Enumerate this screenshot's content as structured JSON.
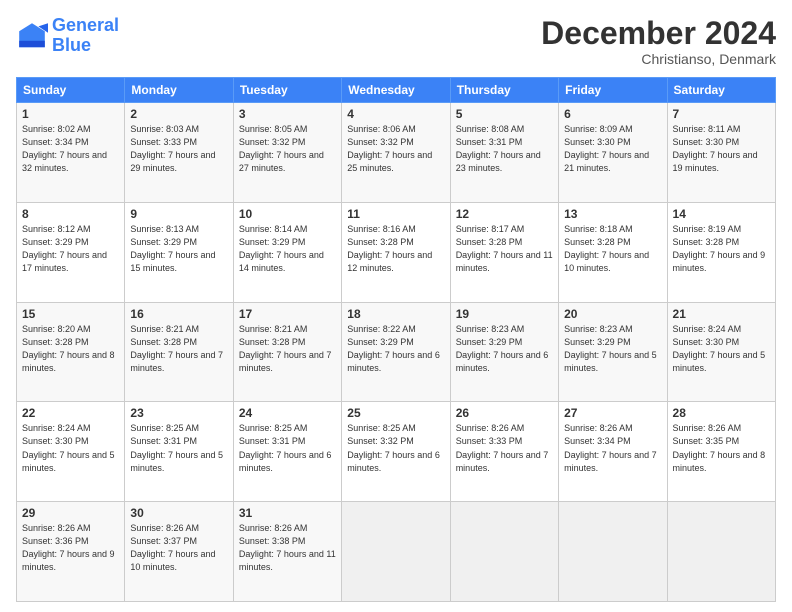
{
  "header": {
    "logo_line1": "General",
    "logo_line2": "Blue",
    "month": "December 2024",
    "location": "Christianso, Denmark"
  },
  "days_of_week": [
    "Sunday",
    "Monday",
    "Tuesday",
    "Wednesday",
    "Thursday",
    "Friday",
    "Saturday"
  ],
  "weeks": [
    [
      {
        "day": "1",
        "sunrise": "8:02 AM",
        "sunset": "3:34 PM",
        "daylight": "7 hours and 32 minutes."
      },
      {
        "day": "2",
        "sunrise": "8:03 AM",
        "sunset": "3:33 PM",
        "daylight": "7 hours and 29 minutes."
      },
      {
        "day": "3",
        "sunrise": "8:05 AM",
        "sunset": "3:32 PM",
        "daylight": "7 hours and 27 minutes."
      },
      {
        "day": "4",
        "sunrise": "8:06 AM",
        "sunset": "3:32 PM",
        "daylight": "7 hours and 25 minutes."
      },
      {
        "day": "5",
        "sunrise": "8:08 AM",
        "sunset": "3:31 PM",
        "daylight": "7 hours and 23 minutes."
      },
      {
        "day": "6",
        "sunrise": "8:09 AM",
        "sunset": "3:30 PM",
        "daylight": "7 hours and 21 minutes."
      },
      {
        "day": "7",
        "sunrise": "8:11 AM",
        "sunset": "3:30 PM",
        "daylight": "7 hours and 19 minutes."
      }
    ],
    [
      {
        "day": "8",
        "sunrise": "8:12 AM",
        "sunset": "3:29 PM",
        "daylight": "7 hours and 17 minutes."
      },
      {
        "day": "9",
        "sunrise": "8:13 AM",
        "sunset": "3:29 PM",
        "daylight": "7 hours and 15 minutes."
      },
      {
        "day": "10",
        "sunrise": "8:14 AM",
        "sunset": "3:29 PM",
        "daylight": "7 hours and 14 minutes."
      },
      {
        "day": "11",
        "sunrise": "8:16 AM",
        "sunset": "3:28 PM",
        "daylight": "7 hours and 12 minutes."
      },
      {
        "day": "12",
        "sunrise": "8:17 AM",
        "sunset": "3:28 PM",
        "daylight": "7 hours and 11 minutes."
      },
      {
        "day": "13",
        "sunrise": "8:18 AM",
        "sunset": "3:28 PM",
        "daylight": "7 hours and 10 minutes."
      },
      {
        "day": "14",
        "sunrise": "8:19 AM",
        "sunset": "3:28 PM",
        "daylight": "7 hours and 9 minutes."
      }
    ],
    [
      {
        "day": "15",
        "sunrise": "8:20 AM",
        "sunset": "3:28 PM",
        "daylight": "7 hours and 8 minutes."
      },
      {
        "day": "16",
        "sunrise": "8:21 AM",
        "sunset": "3:28 PM",
        "daylight": "7 hours and 7 minutes."
      },
      {
        "day": "17",
        "sunrise": "8:21 AM",
        "sunset": "3:28 PM",
        "daylight": "7 hours and 7 minutes."
      },
      {
        "day": "18",
        "sunrise": "8:22 AM",
        "sunset": "3:29 PM",
        "daylight": "7 hours and 6 minutes."
      },
      {
        "day": "19",
        "sunrise": "8:23 AM",
        "sunset": "3:29 PM",
        "daylight": "7 hours and 6 minutes."
      },
      {
        "day": "20",
        "sunrise": "8:23 AM",
        "sunset": "3:29 PM",
        "daylight": "7 hours and 5 minutes."
      },
      {
        "day": "21",
        "sunrise": "8:24 AM",
        "sunset": "3:30 PM",
        "daylight": "7 hours and 5 minutes."
      }
    ],
    [
      {
        "day": "22",
        "sunrise": "8:24 AM",
        "sunset": "3:30 PM",
        "daylight": "7 hours and 5 minutes."
      },
      {
        "day": "23",
        "sunrise": "8:25 AM",
        "sunset": "3:31 PM",
        "daylight": "7 hours and 5 minutes."
      },
      {
        "day": "24",
        "sunrise": "8:25 AM",
        "sunset": "3:31 PM",
        "daylight": "7 hours and 6 minutes."
      },
      {
        "day": "25",
        "sunrise": "8:25 AM",
        "sunset": "3:32 PM",
        "daylight": "7 hours and 6 minutes."
      },
      {
        "day": "26",
        "sunrise": "8:26 AM",
        "sunset": "3:33 PM",
        "daylight": "7 hours and 7 minutes."
      },
      {
        "day": "27",
        "sunrise": "8:26 AM",
        "sunset": "3:34 PM",
        "daylight": "7 hours and 7 minutes."
      },
      {
        "day": "28",
        "sunrise": "8:26 AM",
        "sunset": "3:35 PM",
        "daylight": "7 hours and 8 minutes."
      }
    ],
    [
      {
        "day": "29",
        "sunrise": "8:26 AM",
        "sunset": "3:36 PM",
        "daylight": "7 hours and 9 minutes."
      },
      {
        "day": "30",
        "sunrise": "8:26 AM",
        "sunset": "3:37 PM",
        "daylight": "7 hours and 10 minutes."
      },
      {
        "day": "31",
        "sunrise": "8:26 AM",
        "sunset": "3:38 PM",
        "daylight": "7 hours and 11 minutes."
      },
      null,
      null,
      null,
      null
    ]
  ]
}
